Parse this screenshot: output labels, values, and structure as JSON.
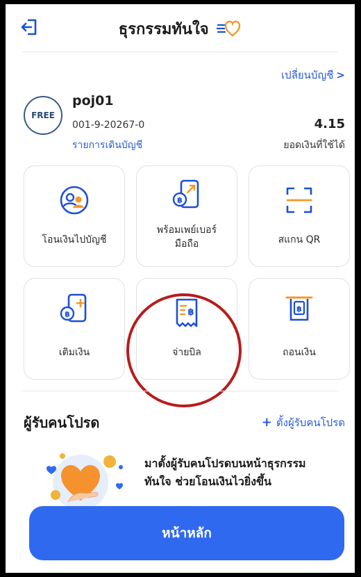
{
  "header": {
    "title": "ธุรกรรมทันใจ",
    "back_icon": "exit-door-icon",
    "logo_icon": "heart-speed-logo-icon"
  },
  "account": {
    "switch_label": "เปลี่ยนบัญชี",
    "switch_chevron": ">",
    "badge": "FREE",
    "name": "poj01",
    "number": "001-9-20267-0",
    "statement_label": "รายการเดินบัญชี",
    "balance": "4.15",
    "balance_label": "ยอดเงินที่ใช้ได้"
  },
  "actions": [
    {
      "label": "โอนเงินไปบัญชี",
      "icon": "people-transfer-icon"
    },
    {
      "label_line1": "พร้อมเพย์เบอร์",
      "label_line2": "มือถือ",
      "icon": "promptpay-phone-icon"
    },
    {
      "label": "สแกน QR",
      "icon": "scan-qr-icon"
    },
    {
      "label": "เติมเงิน",
      "icon": "topup-phone-icon"
    },
    {
      "label": "จ่ายบิล",
      "icon": "bill-payment-icon"
    },
    {
      "label": "ถอนเงิน",
      "icon": "atm-withdraw-icon"
    }
  ],
  "favorites": {
    "title": "ผู้รับคนโปรด",
    "add_plus": "+",
    "add_label": "ตั้งผู้รับคนโปรด",
    "promo_line1": "มาตั้งผู้รับคนโปรดบนหน้าธุรกรรม",
    "promo_line2": "ทันใจ ช่วยโอนเงินไวยิ่งขึ้น",
    "promo_icon": "heart-hand-illustration-icon"
  },
  "footer": {
    "home_label": "หน้าหลัก"
  },
  "colors": {
    "accent": "#2f69f0",
    "link": "#2a5bd7",
    "icon_blue": "#1c4fd8",
    "icon_orange": "#f2992e",
    "highlight_circle": "#b71c1c"
  }
}
